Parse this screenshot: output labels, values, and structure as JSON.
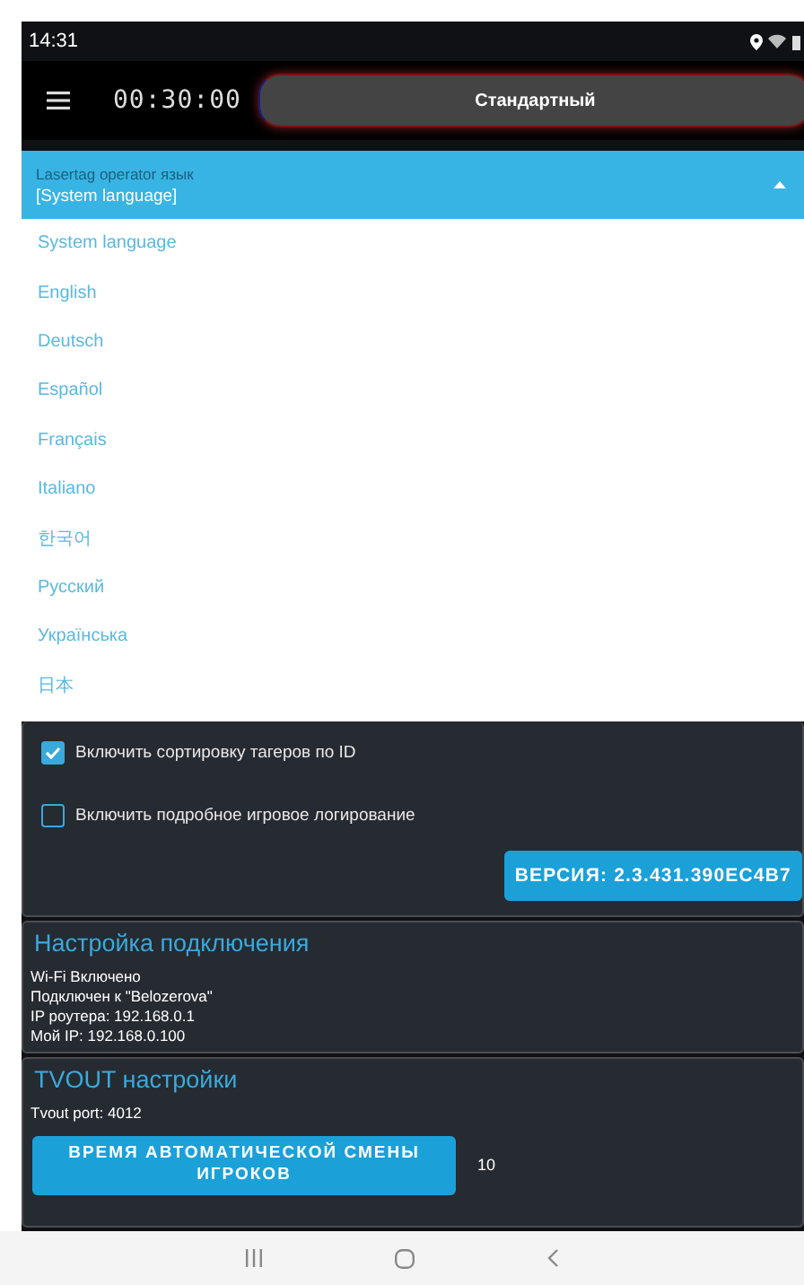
{
  "status_bar": {
    "time": "14:31"
  },
  "top_bar": {
    "timer": "00:30:00",
    "mode_button": "Стандартный"
  },
  "language_dropdown": {
    "label": "Lasertag operator язык",
    "value": "[System language]",
    "expanded": true,
    "options": [
      {
        "label": "System language",
        "selected": false
      },
      {
        "label": "English",
        "selected": false
      },
      {
        "label": "Deutsch",
        "selected": false
      },
      {
        "label": "Español",
        "selected": false
      },
      {
        "label": "Français",
        "selected": false
      },
      {
        "label": "Italiano",
        "selected": false
      },
      {
        "label": "한국어",
        "selected": false
      },
      {
        "label": "Русский",
        "selected": false
      },
      {
        "label": "Українська",
        "selected": false
      },
      {
        "label": "日本",
        "selected": false
      }
    ]
  },
  "checkboxes": [
    {
      "label": "Включить сортировку тагеров по ID",
      "checked": true
    },
    {
      "label": "Включить подробное игровое логирование",
      "checked": false
    }
  ],
  "version_button": "ВЕРСИЯ: 2.3.431.390EC4B7",
  "connection": {
    "title": "Настройка подключения",
    "lines": [
      "Wi-Fi Включено",
      "Подключен к \"Belozerova\"",
      "IP роутера: 192.168.0.1",
      "Мой IP: 192.168.0.100"
    ]
  },
  "tvout": {
    "title": "TVOUT настройки",
    "port": "Tvout port: 4012",
    "button": "ВРЕМЯ АВТОМАТИЧЕСКОЙ СМЕНЫ ИГРОКОВ",
    "value": "10"
  }
}
